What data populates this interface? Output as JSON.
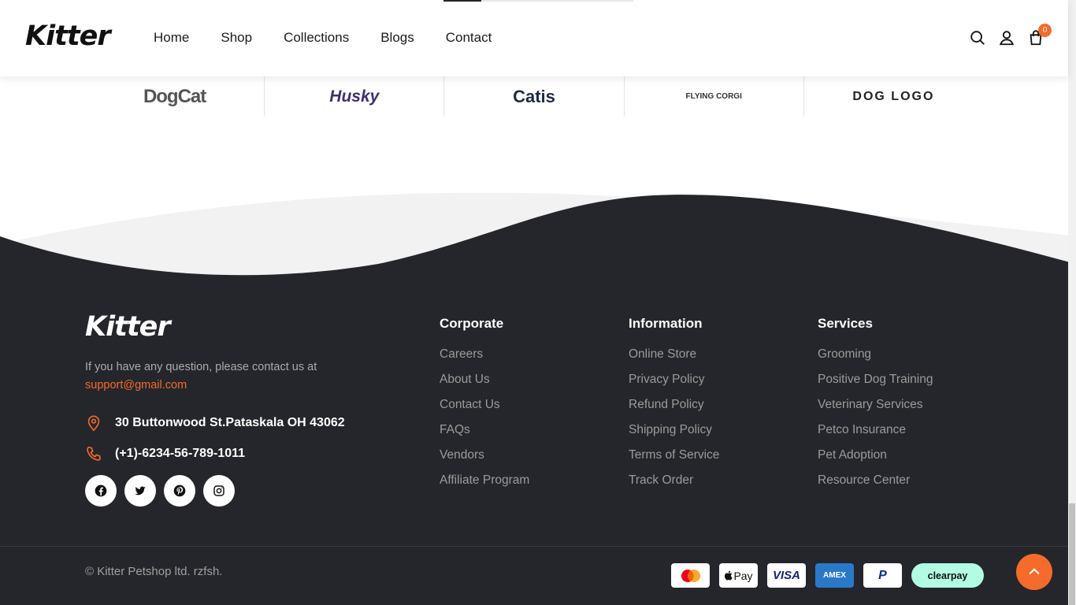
{
  "header": {
    "logo": "Kitter",
    "nav": [
      "Home",
      "Shop",
      "Collections",
      "Blogs",
      "Contact"
    ],
    "cart_count": "0",
    "icons": [
      "search-icon",
      "user-icon",
      "cart-icon"
    ]
  },
  "brands": [
    {
      "name": "DogCat"
    },
    {
      "name": "Husky"
    },
    {
      "name": "Catis"
    },
    {
      "name": "FLYING CORGI"
    },
    {
      "name": "DOG LOGO"
    }
  ],
  "footer": {
    "logo": "Kitter",
    "contact_text": "If you have any question, please contact us at",
    "email": "support@gmail.com",
    "address": "30 Buttonwood St.Pataskala OH 43062",
    "phone": "(+1)-6234-56-789-1011",
    "socials": [
      "facebook-icon",
      "twitter-icon",
      "pinterest-icon",
      "instagram-icon"
    ],
    "columns": [
      {
        "title": "Corporate",
        "links": [
          "Careers",
          "About Us",
          "Contact Us",
          "FAQs",
          "Vendors",
          "Affiliate Program"
        ]
      },
      {
        "title": "Information",
        "links": [
          "Online Store",
          "Privacy Policy",
          "Refund Policy",
          "Shipping Policy",
          "Terms of Service",
          "Track Order"
        ]
      },
      {
        "title": "Services",
        "links": [
          "Grooming",
          "Positive Dog Training",
          "Veterinary Services",
          "Petco Insurance",
          "Pet Adoption",
          "Resource Center"
        ]
      }
    ],
    "copyright": "© Kitter Petshop ltd. rzfsh.",
    "payments": [
      "Pay",
      "VISA",
      "AMEX",
      "P",
      "clearpay"
    ]
  },
  "colors": {
    "accent": "#f46b2b",
    "footer_bg": "#25262b",
    "text_dark": "#1b1b1b"
  }
}
